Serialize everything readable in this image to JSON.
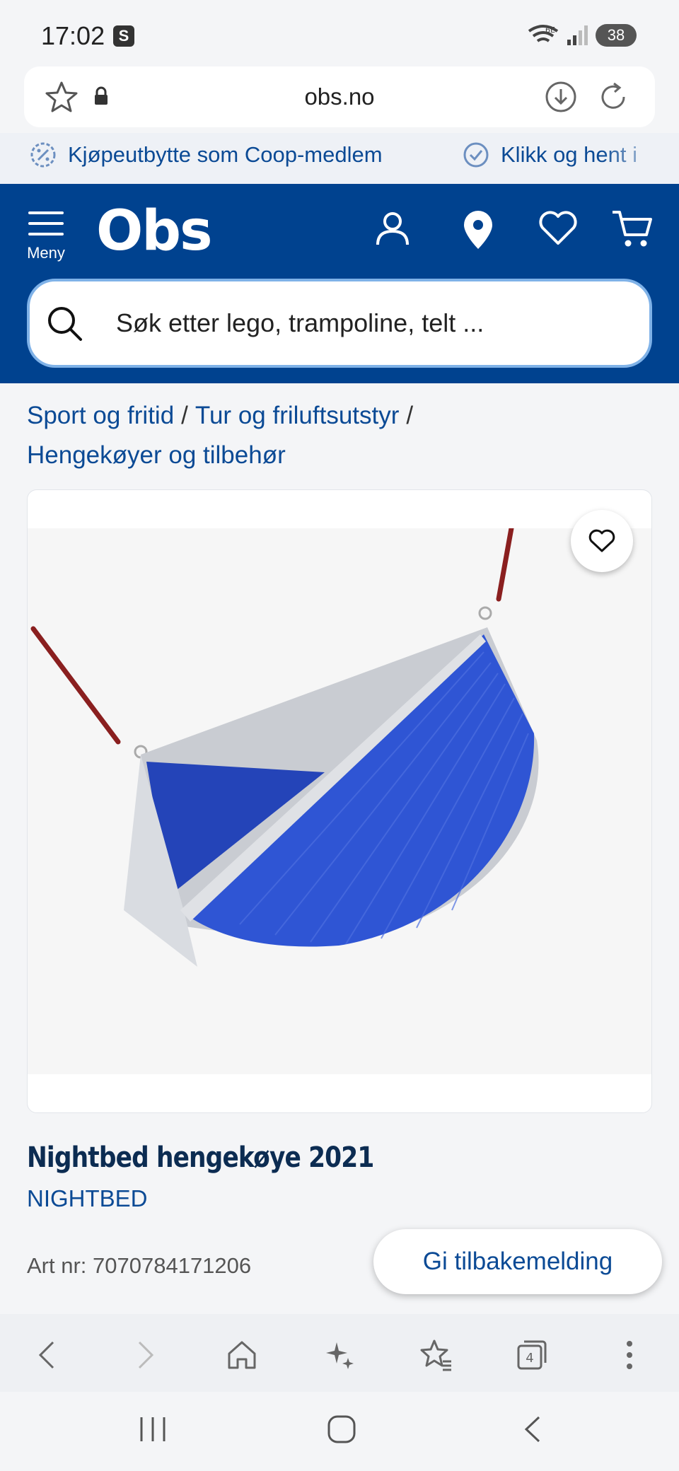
{
  "status_bar": {
    "time": "17:02",
    "notification_badge": "S",
    "network_label": "6E",
    "battery": "38"
  },
  "browser": {
    "url": "obs.no"
  },
  "promo": {
    "items": [
      "Kjøpeutbytte som Coop-medlem",
      "Klikk og hent i"
    ]
  },
  "header": {
    "menu_label": "Meny",
    "logo": "Obs",
    "search_placeholder": "Søk etter lego, trampoline, telt ..."
  },
  "breadcrumb": {
    "items": [
      "Sport og fritid",
      "Tur og friluftsutstyr",
      "Hengekøyer og tilbehør"
    ],
    "separator": "/"
  },
  "product": {
    "title": "Nightbed hengekøye 2021",
    "brand": "NIGHTBED",
    "art_nr_label": "Art nr: 7070784171206",
    "image_colors": {
      "fabric": "#2f55d4",
      "trim": "#c9ccd2",
      "straps": "#8a1f1f"
    }
  },
  "feedback_button": "Gi tilbakemelding",
  "browser_toolbar": {
    "tab_count": "4"
  },
  "colors": {
    "brand_blue": "#00428f",
    "link_blue": "#0b4a95",
    "search_border": "#7fb2e8"
  }
}
